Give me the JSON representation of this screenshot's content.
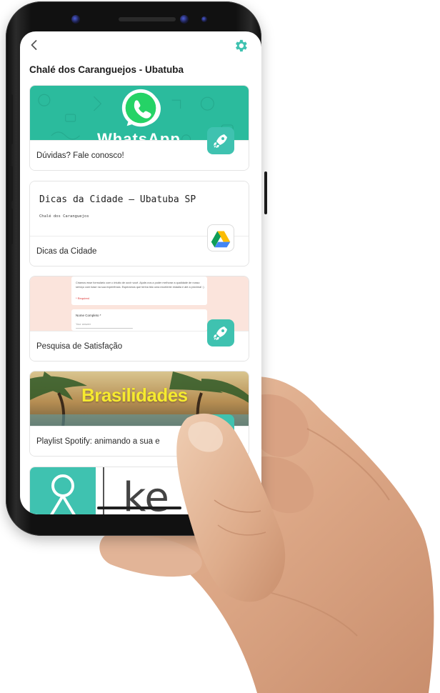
{
  "page": {
    "title": "Chalé dos Caranguejos - Ubatuba"
  },
  "colors": {
    "accent": "#3fc2b0",
    "whatsapp_green": "#2bbb9d",
    "spotify_yellow": "#f6ea2f",
    "form_bg": "#fbe4dc"
  },
  "icons": {
    "back": "chevron-left-icon",
    "settings": "gear-icon",
    "link_type_rocket": "rocket-icon",
    "link_type_drive": "google-drive-icon"
  },
  "cards": [
    {
      "label": "Dúvidas? Fale conosco!",
      "thumb_text": "WhatsApp",
      "badge_icon": "rocket-icon"
    },
    {
      "label": "Dicas da Cidade",
      "thumb_title": "Dicas da Cidade – Ubatuba SP",
      "thumb_subtitle": "Chalé dos Caranguejos",
      "badge_icon": "google-drive-icon"
    },
    {
      "label": "Pesquisa de Satisfação",
      "thumb_form_text": "Criamos esse formulário com o intuito de ouvir você. Ajude-nos a poder melhorar a qualidade de nosso serviço com base na sua experiência. Esperamos que tenha tido uma excelente estadia e até a próxima! :)",
      "thumb_required": "* Required",
      "thumb_question": "Nome Completo *",
      "thumb_answer": "Your answer",
      "badge_icon": "rocket-icon"
    },
    {
      "label": "Playlist Spotify: animando a sua e",
      "thumb_text": "Brasilidades",
      "badge_icon": "rocket-icon"
    },
    {
      "thumb_text": "ke"
    }
  ]
}
